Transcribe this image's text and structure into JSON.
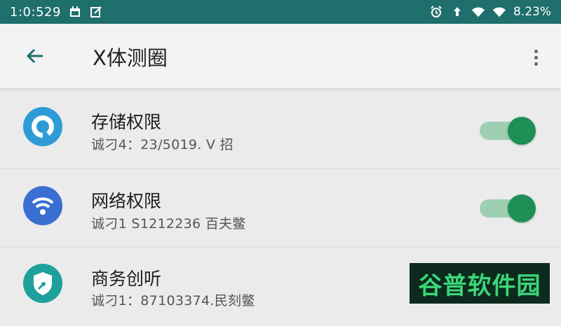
{
  "status_bar": {
    "time": "1:0:529",
    "battery": "8.23%",
    "left_icons": [
      "calendar-icon",
      "edit-icon"
    ],
    "right_icons": [
      "alarm-icon",
      "data-icon",
      "wifi-icon",
      "wifi-icon"
    ]
  },
  "app_bar": {
    "title": "X体测圈",
    "back_icon": "arrow-left-icon",
    "menu_icon": "more-vert-icon"
  },
  "permissions": [
    {
      "title": "存储权限",
      "subtitle": "诚刁4：23/5019. V 招",
      "icon": "storage-icon",
      "icon_color": "#2f9bd6",
      "enabled": true
    },
    {
      "title": "网络权限",
      "subtitle": "诚刁1 S1212236 百夫鳖",
      "icon": "wifi-icon",
      "icon_color": "#3a6fd1",
      "enabled": true
    },
    {
      "title": "商务创听",
      "subtitle": "诚刁1：87103374.民刻鳖",
      "icon": "shield-icon",
      "icon_color": "#1ea19a",
      "enabled": true
    }
  ],
  "watermark": {
    "text": "谷普软件园"
  },
  "colors": {
    "status_bar": "#1f6f6c",
    "toggle_on": "#1e8f55",
    "toggle_track": "#9fcfb3"
  }
}
